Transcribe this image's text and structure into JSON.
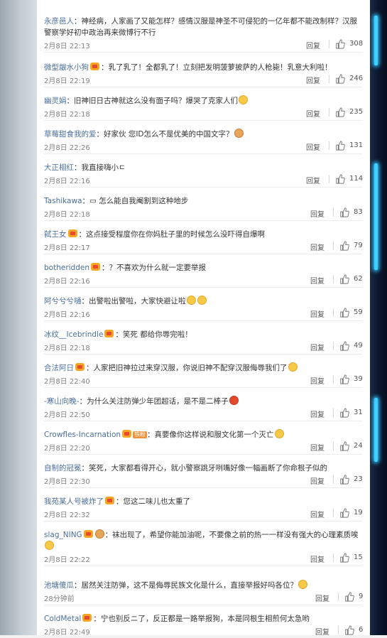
{
  "comments": [
    {
      "user": "永彦邑人",
      "text": "：神经病，人家画了又能怎样？感情汉服是神圣不可侵犯的一亿年都不能改制样？汉服警察学好初中政治再来微博行不行",
      "time": "2月8日 22:13",
      "reply": "回复",
      "likes": "308"
    },
    {
      "user": "微型龈水小狗",
      "text": "：乳了乳了！全都乳了！立刻把发明菠萝披萨的人枪毙！乳意大利啦！",
      "time": "2月8日 22:19",
      "reply": "回复",
      "likes": "246"
    },
    {
      "user": "幽灵娟",
      "text": "：旧神旧日古神就这么没有面子吗？爆哭了克家人们",
      "time": "2月8日 22:18",
      "reply": "回复",
      "likes": "235"
    },
    {
      "user": "草莓甜食我的爱",
      "text": "：好家伙 您ID怎么不是优美的中国文字？",
      "time": "2月8日 22:26",
      "reply": "回复",
      "likes": "131"
    },
    {
      "user": "大正相红",
      "text": "：我直接嗨小ㄷ",
      "time": "2月8日 22:16",
      "reply": "回复",
      "likes": "114"
    },
    {
      "user": "Tashikawa",
      "text": "：▭ 怎么能自我阉割到这种地步",
      "time": "2月8日 22:18",
      "reply": "回复",
      "likes": "83"
    },
    {
      "user": "弑王女",
      "text": "：这点接受程度你在你妈肚子里的时候怎么没吓得自爆啊",
      "time": "2月8日 22:17",
      "reply": "回复",
      "likes": "79"
    },
    {
      "user": "botheridden",
      "text": "：？不喜欢为什么就一定要举报",
      "time": "2月8日 22:16",
      "reply": "回复",
      "likes": "62"
    },
    {
      "user": "阿兮兮兮嗵",
      "text": "：出警啦出警啦，大家快避让啦",
      "time": "2月8日 22:16",
      "reply": "回复",
      "likes": "59"
    },
    {
      "user": "冰纹__Icebrindle",
      "text": "：笑死 都给你辱完啦！",
      "time": "2月8日 22:18",
      "reply": "回复",
      "likes": "49"
    },
    {
      "user": "合法阿日",
      "text": "：人家把旧神拉过来穿汉服，你说旧神不配穿汉服侮辱我们了",
      "time": "2月8日 22:40",
      "reply": "回复",
      "likes": "39"
    },
    {
      "user": "-寒山向晚-",
      "text": "：为什么关注防弹少年团超话，是不是二棒子",
      "time": "2月8日 22:50",
      "reply": "回复",
      "likes": "31"
    },
    {
      "user": "Crowfles-Incarnation",
      "badge": "铁粉",
      "text": "：真要像你这样说和服文化第一个灭亡",
      "time": "2月8日 22:20",
      "reply": "回复",
      "likes": "24"
    },
    {
      "user": "自制的冠冕",
      "text": "：笑死，大家都看得开心，就小警察跳牙咧嘴好像一幅画断了你命根子似的",
      "time": "2月8日 22:30",
      "reply": "回复",
      "likes": "23"
    },
    {
      "user": "我苑某人号被炸了",
      "text": "：您这二味儿也太重了",
      "time": "2月8日 22:32",
      "reply": "回复",
      "likes": "19"
    },
    {
      "user": "slag_NING",
      "text": "：袜出现了，希望你能加油呢，不要像之前的热一一样没有强大的心理素质唉",
      "time": "2月8日 22:22",
      "reply": "回复",
      "likes": "15"
    },
    {
      "user": "池塘傻瓜",
      "text": "：居然关注防弹，这不是侮辱民族文化是什么，直接举报好吗各位？",
      "time": "28分钟前",
      "reply": "回复",
      "likes": "9"
    },
    {
      "user": "ColdMetal",
      "text": "：宁也别反ニ了，反正都是一路举报狗，本是同根生相煎何太急哟",
      "time": "2月8日 22:49",
      "reply": "回复",
      "likes": "6"
    }
  ]
}
